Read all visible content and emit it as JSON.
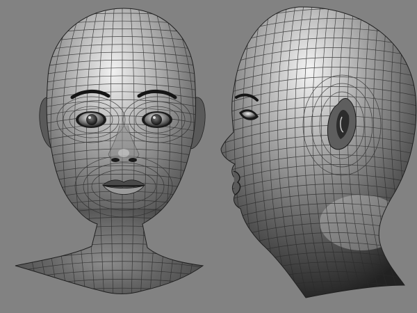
{
  "scene": {
    "background_color": "#828282",
    "mesh_line_color": "#2b2b2b",
    "skin_dark": "#2a2a2a",
    "skin_mid": "#6e6e6e",
    "skin_light": "#e6e6e6",
    "views": [
      {
        "view": "front",
        "subject": "female-head-wireframe"
      },
      {
        "view": "side",
        "subject": "female-head-wireframe"
      }
    ]
  }
}
